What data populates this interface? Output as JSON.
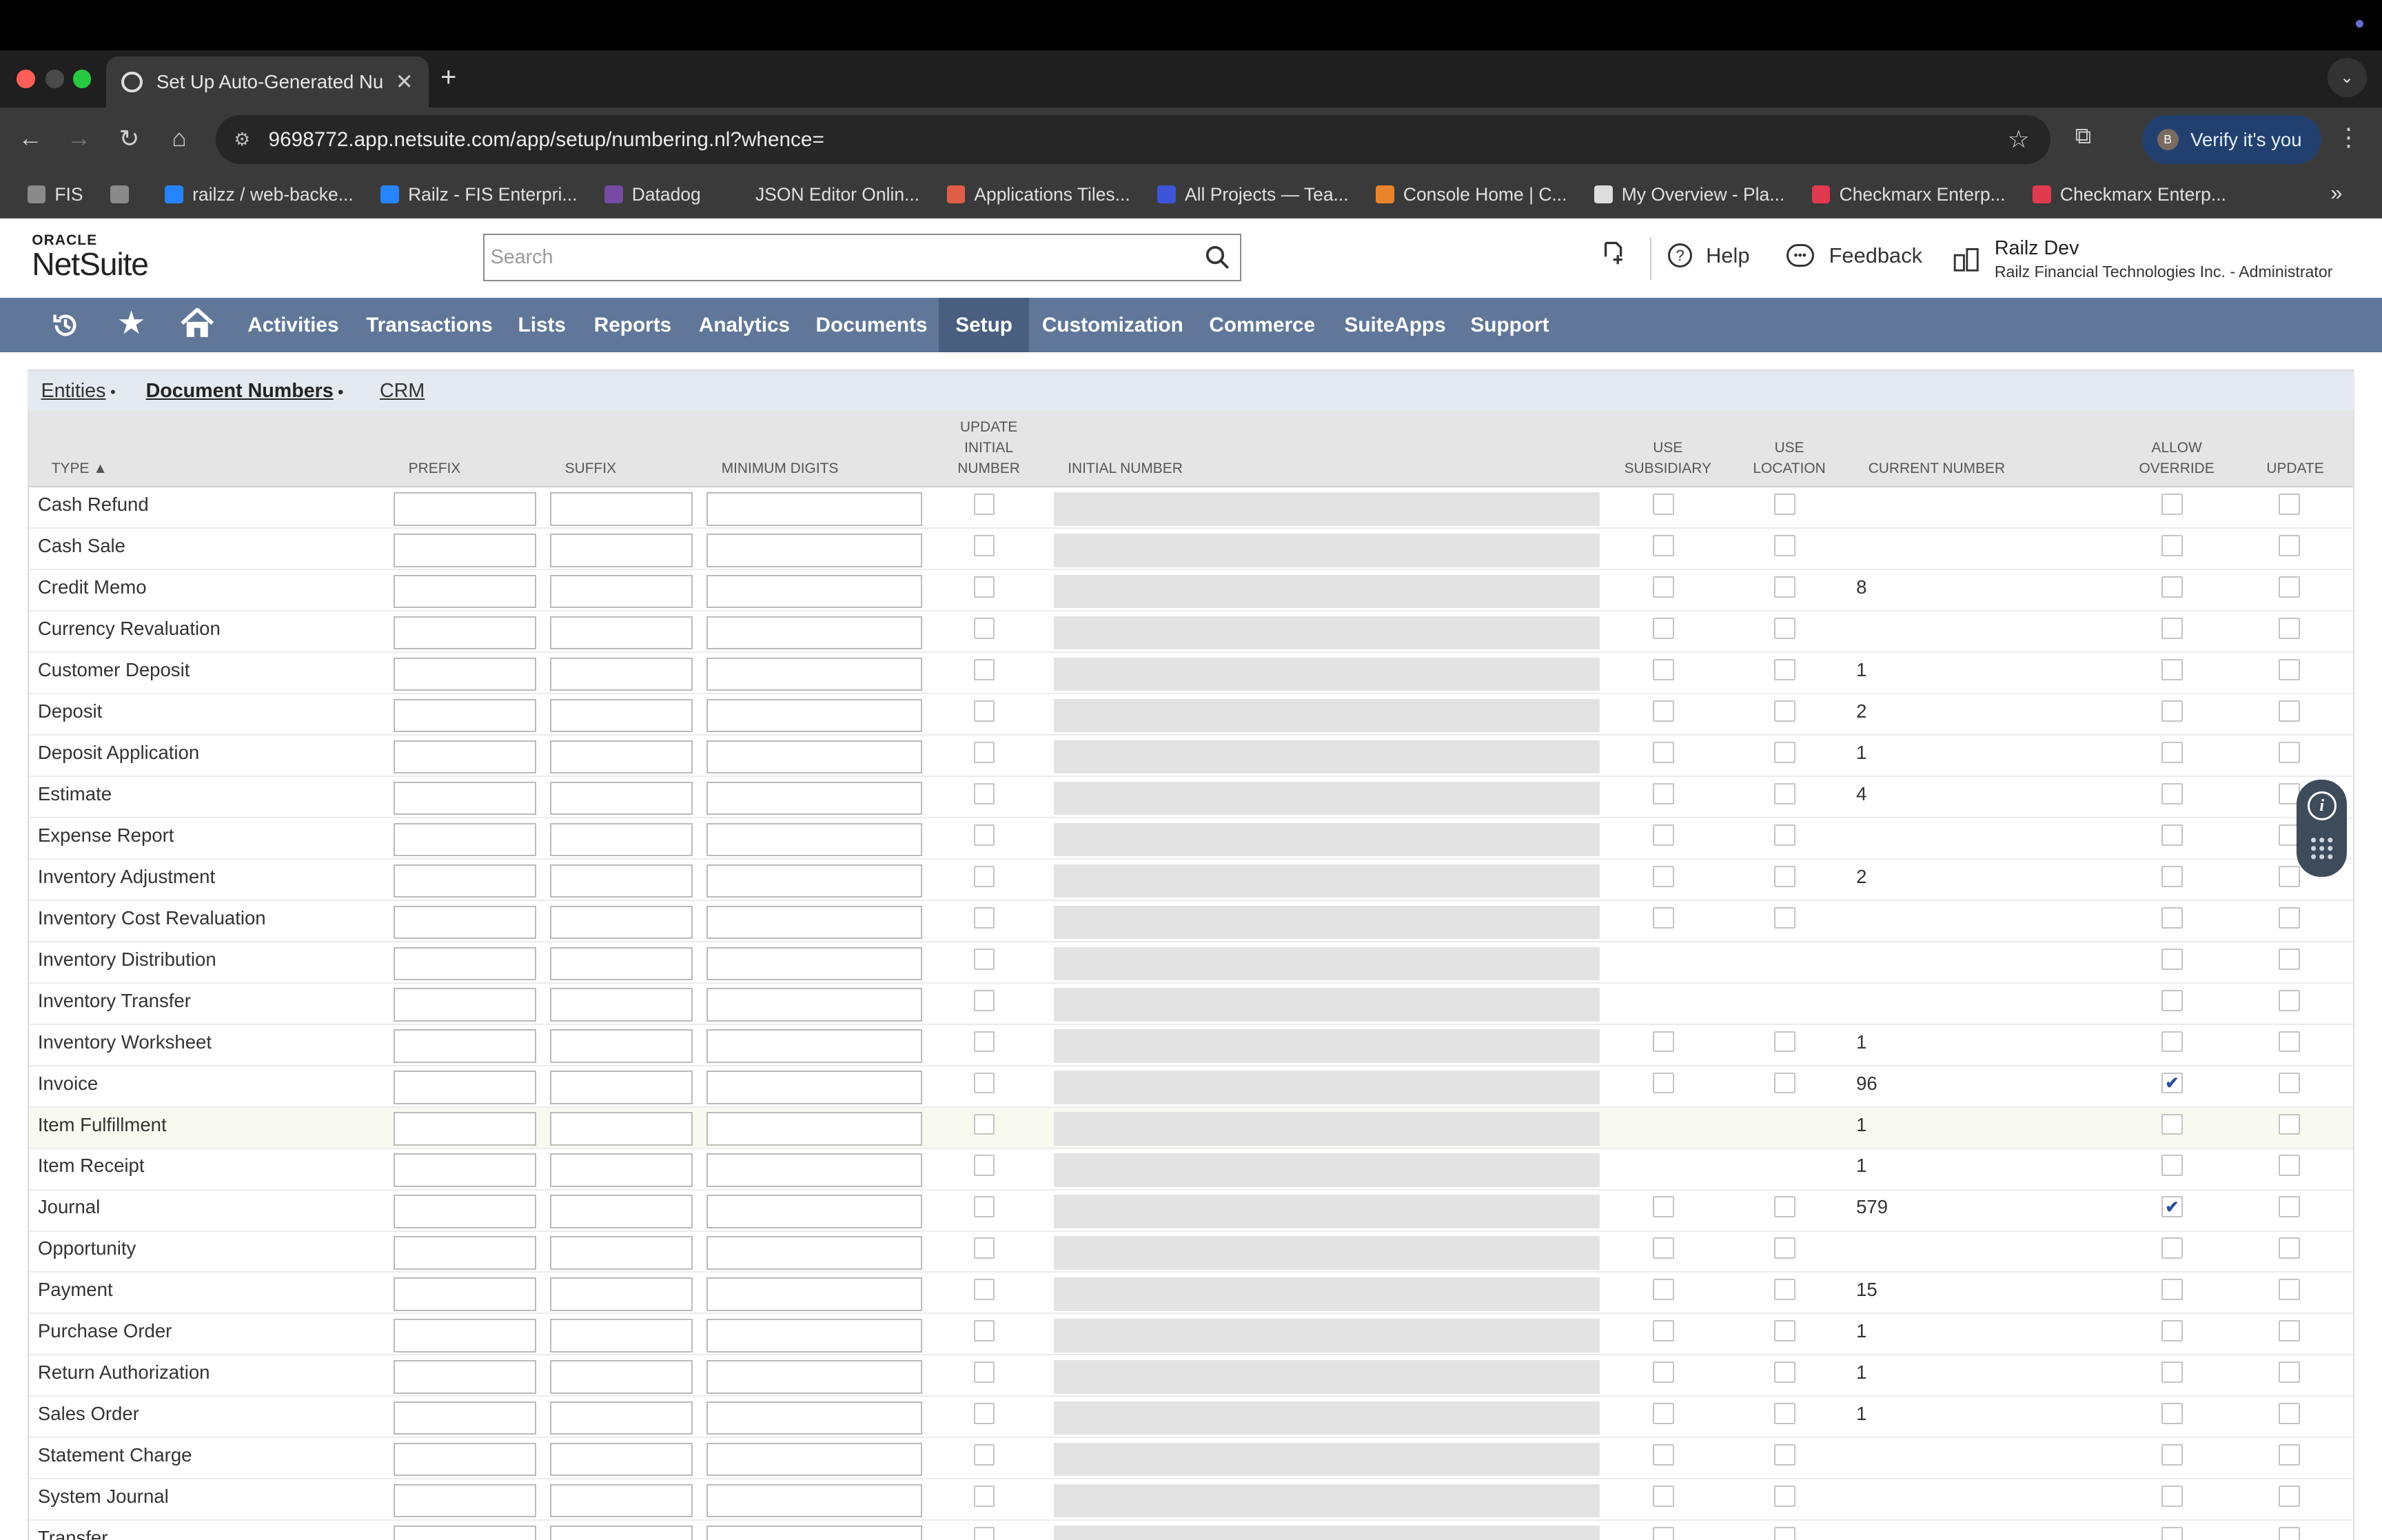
{
  "browser": {
    "tab_title": "Set Up Auto-Generated Numb",
    "url": "9698772.app.netsuite.com/app/setup/numbering.nl?whence=",
    "verify": "Verify it's you",
    "avatar": "B"
  },
  "bookmarks": [
    {
      "label": "FIS",
      "color": "#8a8a8a"
    },
    {
      "label": "",
      "color": "#8a8a8a"
    },
    {
      "label": "railzz / web-backe...",
      "color": "#2684ff"
    },
    {
      "label": "Railz - FIS Enterpri...",
      "color": "#2684ff"
    },
    {
      "label": "Datadog",
      "color": "#774aa4"
    },
    {
      "label": "JSON Editor Onlin...",
      "color": "#3a3a3a"
    },
    {
      "label": "Applications Tiles...",
      "color": "#e05e48"
    },
    {
      "label": "All Projects — Tea...",
      "color": "#3d55d8"
    },
    {
      "label": "Console Home | C...",
      "color": "#e8852c"
    },
    {
      "label": "My Overview - Pla...",
      "color": "#ddd"
    },
    {
      "label": "Checkmarx Enterp...",
      "color": "#e03a50"
    },
    {
      "label": "Checkmarx Enterp...",
      "color": "#e03a50"
    }
  ],
  "header": {
    "logo_top": "ORACLE",
    "logo_main": "NetSuite",
    "search_placeholder": "Search",
    "help": "Help",
    "feedback": "Feedback",
    "user_name": "Railz Dev",
    "user_role": "Railz Financial Technologies Inc. - Administrator"
  },
  "menu": [
    "Activities",
    "Transactions",
    "Lists",
    "Reports",
    "Analytics",
    "Documents",
    "Setup",
    "Customization",
    "Commerce",
    "SuiteApps",
    "Support"
  ],
  "subtabs": {
    "entities": "Entities",
    "doc_numbers": "Document Numbers",
    "crm": "CRM"
  },
  "columns": {
    "type": "TYPE ▲",
    "prefix": "PREFIX",
    "suffix": "SUFFIX",
    "min_digits": "MINIMUM DIGITS",
    "update_initial": "UPDATE INITIAL NUMBER",
    "initial": "INITIAL NUMBER",
    "use_sub": "USE SUBSIDIARY",
    "use_loc": "USE LOCATION",
    "current": "CURRENT NUMBER",
    "allow": "ALLOW OVERRIDE",
    "update": "UPDATE"
  },
  "rows": [
    {
      "type": "Cash Refund",
      "sub": true,
      "loc": true,
      "cur": "",
      "ovr": false
    },
    {
      "type": "Cash Sale",
      "sub": true,
      "loc": true,
      "cur": "",
      "ovr": false
    },
    {
      "type": "Credit Memo",
      "sub": true,
      "loc": true,
      "cur": "8",
      "ovr": false
    },
    {
      "type": "Currency Revaluation",
      "sub": true,
      "loc": true,
      "cur": "",
      "ovr": false
    },
    {
      "type": "Customer Deposit",
      "sub": true,
      "loc": true,
      "cur": "1",
      "ovr": false
    },
    {
      "type": "Deposit",
      "sub": true,
      "loc": true,
      "cur": "2",
      "ovr": false
    },
    {
      "type": "Deposit Application",
      "sub": true,
      "loc": true,
      "cur": "1",
      "ovr": false
    },
    {
      "type": "Estimate",
      "sub": true,
      "loc": true,
      "cur": "4",
      "ovr": false
    },
    {
      "type": "Expense Report",
      "sub": true,
      "loc": true,
      "cur": "",
      "ovr": false
    },
    {
      "type": "Inventory Adjustment",
      "sub": true,
      "loc": true,
      "cur": "2",
      "ovr": false
    },
    {
      "type": "Inventory Cost Revaluation",
      "sub": true,
      "loc": true,
      "cur": "",
      "ovr": false
    },
    {
      "type": "Inventory Distribution",
      "sub": false,
      "loc": false,
      "cur": "",
      "ovr": false
    },
    {
      "type": "Inventory Transfer",
      "sub": false,
      "loc": false,
      "cur": "",
      "ovr": false
    },
    {
      "type": "Inventory Worksheet",
      "sub": true,
      "loc": true,
      "cur": "1",
      "ovr": false
    },
    {
      "type": "Invoice",
      "sub": true,
      "loc": true,
      "cur": "96",
      "ovr": true
    },
    {
      "type": "Item Fulfillment",
      "sub": false,
      "loc": false,
      "cur": "1",
      "ovr": false
    },
    {
      "type": "Item Receipt",
      "sub": false,
      "loc": false,
      "cur": "1",
      "ovr": false
    },
    {
      "type": "Journal",
      "sub": true,
      "loc": true,
      "cur": "579",
      "ovr": true
    },
    {
      "type": "Opportunity",
      "sub": true,
      "loc": true,
      "cur": "",
      "ovr": false
    },
    {
      "type": "Payment",
      "sub": true,
      "loc": true,
      "cur": "15",
      "ovr": false
    },
    {
      "type": "Purchase Order",
      "sub": true,
      "loc": true,
      "cur": "1",
      "ovr": false
    },
    {
      "type": "Return Authorization",
      "sub": true,
      "loc": true,
      "cur": "1",
      "ovr": false
    },
    {
      "type": "Sales Order",
      "sub": true,
      "loc": true,
      "cur": "1",
      "ovr": false
    },
    {
      "type": "Statement Charge",
      "sub": true,
      "loc": true,
      "cur": "",
      "ovr": false
    },
    {
      "type": "System Journal",
      "sub": true,
      "loc": true,
      "cur": "",
      "ovr": false
    },
    {
      "type": "Transfer",
      "sub": true,
      "loc": true,
      "cur": "",
      "ovr": false
    }
  ]
}
